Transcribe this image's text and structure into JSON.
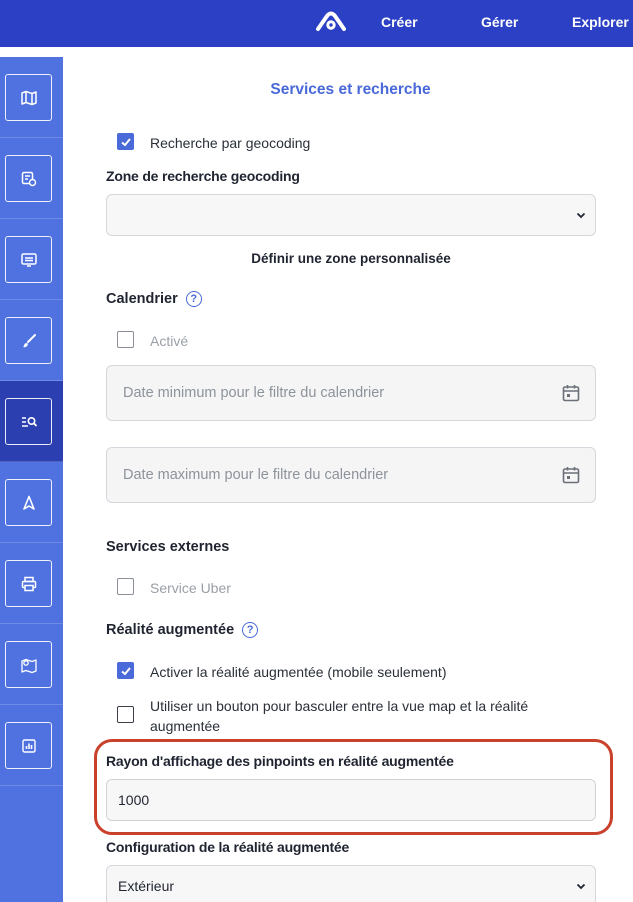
{
  "header": {
    "nav": [
      {
        "label": "Créer"
      },
      {
        "label": "Gérer"
      },
      {
        "label": "Explorer"
      }
    ]
  },
  "sidebar": {
    "items": [
      {
        "icon": "map-icon"
      },
      {
        "icon": "layers-icon"
      },
      {
        "icon": "screen-icon"
      },
      {
        "icon": "brush-icon"
      },
      {
        "icon": "search-list-icon",
        "active": true
      },
      {
        "icon": "navigation-icon"
      },
      {
        "icon": "printer-icon"
      },
      {
        "icon": "location-map-icon"
      },
      {
        "icon": "bar-chart-icon"
      }
    ]
  },
  "main": {
    "title": "Services et recherche",
    "geocoding": {
      "checkbox_label": "Recherche par geocoding",
      "checked": true,
      "zone_label": "Zone de recherche geocoding",
      "zone_value": "",
      "custom_zone_link": "Définir une zone personnalisée"
    },
    "calendar": {
      "title": "Calendrier",
      "help": "?",
      "active_label": "Activé",
      "min_placeholder": "Date minimum pour le filtre du calendrier",
      "max_placeholder": "Date maximum pour le filtre du calendrier"
    },
    "external_services": {
      "title": "Services externes",
      "uber_label": "Service Uber"
    },
    "augmented_reality": {
      "title": "Réalité augmentée",
      "help": "?",
      "enable_label": "Activer la réalité augmentée (mobile seulement)",
      "toggle_button_label": "Utiliser un bouton pour basculer entre la vue map et la réalité augmentée",
      "radius_label": "Rayon d'affichage des pinpoints en réalité augmentée",
      "radius_value": "1000",
      "config_label": "Configuration de la réalité augmentée",
      "config_value": "Extérieur"
    }
  },
  "colors": {
    "topbar": "#2b40c4",
    "sidebar": "#4f72e0",
    "sidebar_active": "#2c3fb0",
    "accent": "#4a69d8",
    "highlight": "#c9412b"
  }
}
